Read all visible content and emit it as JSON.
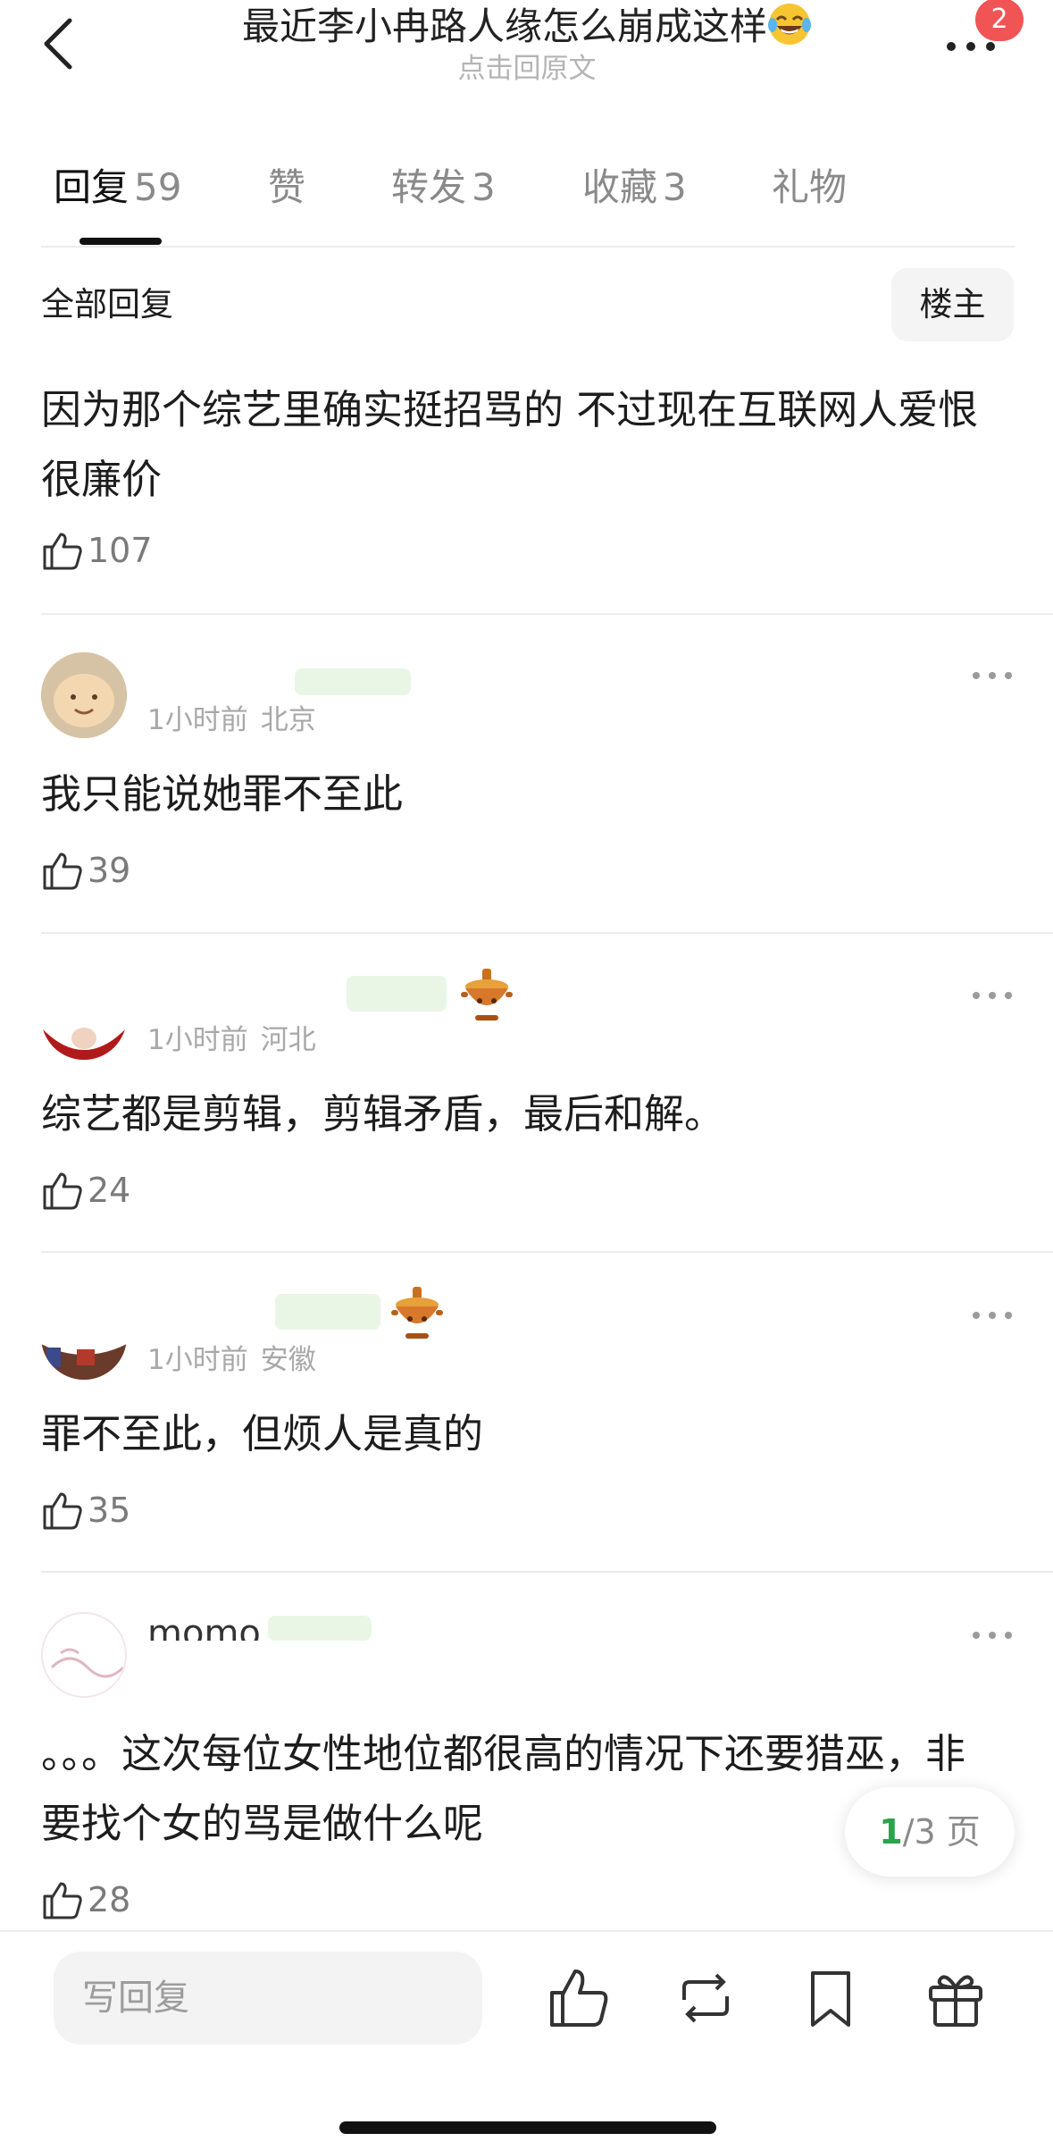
{
  "header": {
    "title": "最近李小冉路人缘怎么崩成这样",
    "subtitle": "点击回原文",
    "badge_count": "2"
  },
  "tabs": [
    {
      "label": "回复",
      "count": "59",
      "active": true
    },
    {
      "label": "赞",
      "count": "",
      "active": false
    },
    {
      "label": "转发",
      "count": "3",
      "active": false
    },
    {
      "label": "收藏",
      "count": "3",
      "active": false
    },
    {
      "label": "礼物",
      "count": "",
      "active": false
    }
  ],
  "section": {
    "title": "全部回复",
    "op_filter_label": "楼主"
  },
  "op_comment": {
    "text": "因为那个综艺里确实挺招骂的 不过现在互联网人爱恨很廉价",
    "likes": "107"
  },
  "comments": [
    {
      "time": "1小时前",
      "location": "北京",
      "text": "我只能说她罪不至此",
      "likes": "39"
    },
    {
      "time": "1小时前",
      "location": "河北",
      "text": "综艺都是剪辑，剪辑矛盾，最后和解。",
      "likes": "24"
    },
    {
      "time": "1小时前",
      "location": "安徽",
      "text": "罪不至此，但烦人是真的",
      "likes": "35"
    },
    {
      "name": "momo",
      "text": "。。。这次每位女性地位都很高的情况下还要猎巫，非要找个女的骂是做什么呢",
      "likes": "28"
    }
  ],
  "pager": {
    "current": "1",
    "rest": "/3 页"
  },
  "bottom_bar": {
    "reply_placeholder": "写回复"
  },
  "colors": {
    "accent_green": "#2aa34a",
    "badge_red": "#f15454"
  }
}
